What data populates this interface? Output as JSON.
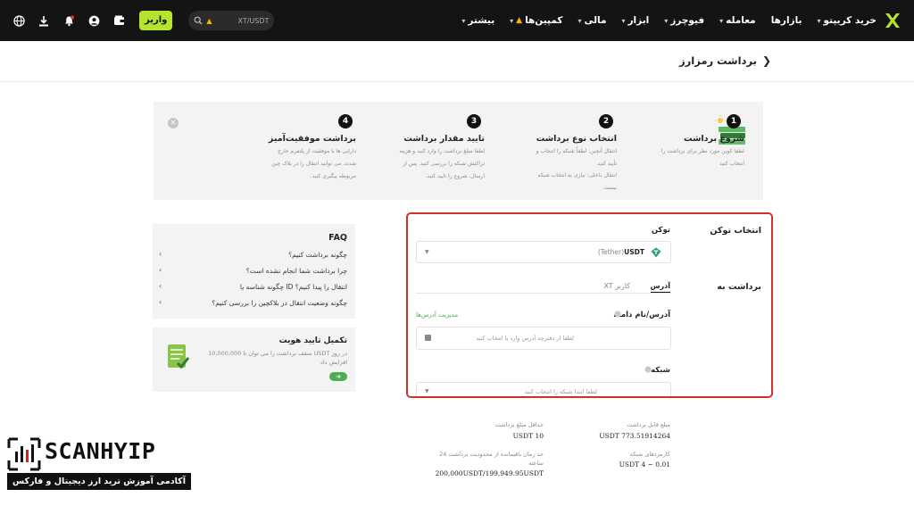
{
  "nav": {
    "items": [
      {
        "label": "خرید کریپتو",
        "chev": true,
        "fire": false
      },
      {
        "label": "بازارها",
        "chev": false,
        "fire": false
      },
      {
        "label": "معامله",
        "chev": true,
        "fire": false
      },
      {
        "label": "فیوچرز",
        "chev": true,
        "fire": false
      },
      {
        "label": "ابزار",
        "chev": true,
        "fire": false
      },
      {
        "label": "مالی",
        "chev": true,
        "fire": false
      },
      {
        "label": "کمپین‌ها",
        "chev": true,
        "fire": true
      },
      {
        "label": "بیشتر",
        "chev": true,
        "fire": false
      }
    ],
    "deposit_label": "واریز",
    "search_text": "XT/USDT",
    "brand_color": "#b5e42f"
  },
  "page": {
    "title": "برداشت رمزارز",
    "back_icon": "chevron-right-icon"
  },
  "steps": [
    {
      "num": "1",
      "title": "شروع برداشت",
      "desc": [
        "لطفا کوین مورد نظر برای برداشت را",
        "انتخاب کنید"
      ]
    },
    {
      "num": "2",
      "title": "انتخاب نوع برداشت",
      "desc": [
        "انتقال آنچین: لطفاً شبکه را انتخاب و",
        "تأیید کنید",
        "انتقال داخلی: نیازی به انتخاب شبکه",
        "نیست"
      ]
    },
    {
      "num": "3",
      "title": "تایید مقدار برداشت",
      "desc": [
        "لطفا مبلغ برداشت را وارد کنید و هزینه",
        "تراکنش شبکه را بررسی کنید. پس از",
        "ارسال، شروع را تایید کنید."
      ]
    },
    {
      "num": "4",
      "title": "برداشت موفقیت‌آمیز",
      "desc": [
        "دارایی ها با موفقیت از پلتفرم خارج",
        "شدند. می توانید انتقال را در بلاک چین",
        "مربوطه پیگیری کنید."
      ]
    }
  ],
  "form": {
    "select_token_label": "انتخاب توکن",
    "token_label": "توکن",
    "token_value": "USDT",
    "token_name": "(Tether)",
    "withdraw_to_label": "برداشت به",
    "tab_address": "آدرس",
    "tab_xt": "XT کاربر",
    "address_label": "آدرس/نام دامنه",
    "manage_addresses": "مدیریت آدرس‌ها",
    "address_placeholder": "لطفا از دفترچه آدرس وارد یا انتخاب کنید",
    "network_label": "شبکه",
    "network_placeholder": "لطفا ابتدا شبکه را انتخاب کنید"
  },
  "faq": {
    "title": "FAQ",
    "items": [
      "چگونه برداشت کنیم؟",
      "چرا برداشت شما انجام نشده است؟",
      "چگونه شناسه یا ID انتقال را پیدا کنیم؟",
      "چگونه وضعیت انتقال در بلاکچین را بررسی کنیم؟"
    ]
  },
  "kyc": {
    "title": "تکمیل تایید هویت",
    "desc_line1": "سقف برداشت را می توان تا 10,000,000 USDT در روز",
    "desc_line2": "افزایش داد"
  },
  "info": {
    "available_label": "مبلغ قابل برداشت",
    "available_value": "USDT 773.51914264",
    "min_label": "حداقل مبلغ برداشت",
    "min_value": "USDT 10",
    "fee_label": "کارمزدهای شبکه",
    "fee_value": "USDT 4 ~ 0.01",
    "limit_label_1": "حد زمان باقیمانده از محدودیت برداشت 24",
    "limit_label_2": "ساعته",
    "limit_value": "200,000USDT/199,949.95USDT"
  },
  "watermark": {
    "brand": "SCANHYIP",
    "tagline": "آکادمی آموزش ترید ارز دیجیتال و فارکس"
  }
}
